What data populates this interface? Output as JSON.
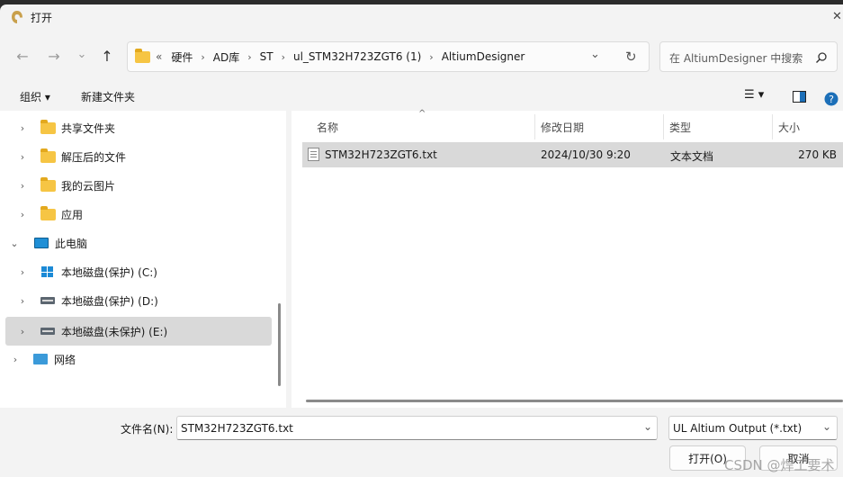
{
  "window": {
    "title": "打开",
    "close_glyph": "✕"
  },
  "nav": {
    "back": "←",
    "forward": "→",
    "recent": "⌄",
    "up": "↑"
  },
  "address": {
    "overflow": "«",
    "crumbs": [
      "硬件",
      "AD库",
      "ST",
      "ul_STM32H723ZGT6 (1)",
      "AltiumDesigner"
    ],
    "separator": "›",
    "dropdown": "⌄",
    "refresh": "↻"
  },
  "search": {
    "placeholder": "在 AltiumDesigner 中搜索"
  },
  "toolbar": {
    "organize": "组织 ▾",
    "new_folder": "新建文件夹",
    "view_menu": "☰ ▾"
  },
  "sidebar": {
    "items": [
      {
        "label": "共享文件夹",
        "icon": "shared-folder"
      },
      {
        "label": "解压后的文件",
        "icon": "folder"
      },
      {
        "label": "我的云图片",
        "icon": "folder"
      },
      {
        "label": "应用",
        "icon": "folder"
      },
      {
        "label": "此电脑",
        "icon": "computer"
      },
      {
        "label": "本地磁盘(保护) (C:)",
        "icon": "windows-drive"
      },
      {
        "label": "本地磁盘(保护) (D:)",
        "icon": "drive"
      },
      {
        "label": "本地磁盘(未保护) (E:)",
        "icon": "drive"
      },
      {
        "label": "网络",
        "icon": "network"
      }
    ]
  },
  "file_list": {
    "columns": [
      "名称",
      "修改日期",
      "类型",
      "大小"
    ],
    "rows": [
      {
        "name": "STM32H723ZGT6.txt",
        "modified": "2024/10/30 9:20",
        "type": "文本文档",
        "size": "270 KB"
      }
    ]
  },
  "footer": {
    "filename_label": "文件名(N):",
    "filename_value": "STM32H723ZGT6.txt",
    "filter_value": "UL Altium Output (*.txt)",
    "open_button": "打开(O)",
    "cancel_button": "取消"
  },
  "watermark": "CSDN @焊工要术",
  "colors": {
    "folder": "#f6c544",
    "selection": "#d9d9d9",
    "accent": "#1c8ad6"
  }
}
